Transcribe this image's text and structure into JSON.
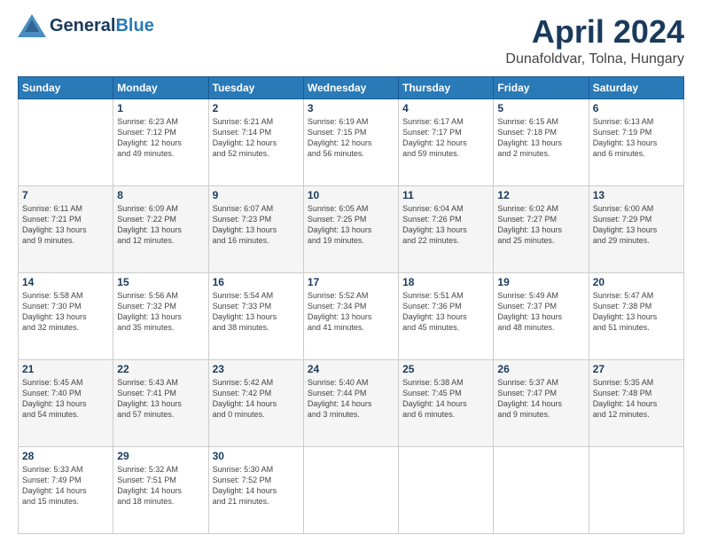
{
  "header": {
    "logo_general": "General",
    "logo_blue": "Blue",
    "title": "April 2024",
    "subtitle": "Dunafoldvar, Tolna, Hungary"
  },
  "days": [
    "Sunday",
    "Monday",
    "Tuesday",
    "Wednesday",
    "Thursday",
    "Friday",
    "Saturday"
  ],
  "weeks": [
    [
      {
        "day": "",
        "content": ""
      },
      {
        "day": "1",
        "content": "Sunrise: 6:23 AM\nSunset: 7:12 PM\nDaylight: 12 hours\nand 49 minutes."
      },
      {
        "day": "2",
        "content": "Sunrise: 6:21 AM\nSunset: 7:14 PM\nDaylight: 12 hours\nand 52 minutes."
      },
      {
        "day": "3",
        "content": "Sunrise: 6:19 AM\nSunset: 7:15 PM\nDaylight: 12 hours\nand 56 minutes."
      },
      {
        "day": "4",
        "content": "Sunrise: 6:17 AM\nSunset: 7:17 PM\nDaylight: 12 hours\nand 59 minutes."
      },
      {
        "day": "5",
        "content": "Sunrise: 6:15 AM\nSunset: 7:18 PM\nDaylight: 13 hours\nand 2 minutes."
      },
      {
        "day": "6",
        "content": "Sunrise: 6:13 AM\nSunset: 7:19 PM\nDaylight: 13 hours\nand 6 minutes."
      }
    ],
    [
      {
        "day": "7",
        "content": "Sunrise: 6:11 AM\nSunset: 7:21 PM\nDaylight: 13 hours\nand 9 minutes."
      },
      {
        "day": "8",
        "content": "Sunrise: 6:09 AM\nSunset: 7:22 PM\nDaylight: 13 hours\nand 12 minutes."
      },
      {
        "day": "9",
        "content": "Sunrise: 6:07 AM\nSunset: 7:23 PM\nDaylight: 13 hours\nand 16 minutes."
      },
      {
        "day": "10",
        "content": "Sunrise: 6:05 AM\nSunset: 7:25 PM\nDaylight: 13 hours\nand 19 minutes."
      },
      {
        "day": "11",
        "content": "Sunrise: 6:04 AM\nSunset: 7:26 PM\nDaylight: 13 hours\nand 22 minutes."
      },
      {
        "day": "12",
        "content": "Sunrise: 6:02 AM\nSunset: 7:27 PM\nDaylight: 13 hours\nand 25 minutes."
      },
      {
        "day": "13",
        "content": "Sunrise: 6:00 AM\nSunset: 7:29 PM\nDaylight: 13 hours\nand 29 minutes."
      }
    ],
    [
      {
        "day": "14",
        "content": "Sunrise: 5:58 AM\nSunset: 7:30 PM\nDaylight: 13 hours\nand 32 minutes."
      },
      {
        "day": "15",
        "content": "Sunrise: 5:56 AM\nSunset: 7:32 PM\nDaylight: 13 hours\nand 35 minutes."
      },
      {
        "day": "16",
        "content": "Sunrise: 5:54 AM\nSunset: 7:33 PM\nDaylight: 13 hours\nand 38 minutes."
      },
      {
        "day": "17",
        "content": "Sunrise: 5:52 AM\nSunset: 7:34 PM\nDaylight: 13 hours\nand 41 minutes."
      },
      {
        "day": "18",
        "content": "Sunrise: 5:51 AM\nSunset: 7:36 PM\nDaylight: 13 hours\nand 45 minutes."
      },
      {
        "day": "19",
        "content": "Sunrise: 5:49 AM\nSunset: 7:37 PM\nDaylight: 13 hours\nand 48 minutes."
      },
      {
        "day": "20",
        "content": "Sunrise: 5:47 AM\nSunset: 7:38 PM\nDaylight: 13 hours\nand 51 minutes."
      }
    ],
    [
      {
        "day": "21",
        "content": "Sunrise: 5:45 AM\nSunset: 7:40 PM\nDaylight: 13 hours\nand 54 minutes."
      },
      {
        "day": "22",
        "content": "Sunrise: 5:43 AM\nSunset: 7:41 PM\nDaylight: 13 hours\nand 57 minutes."
      },
      {
        "day": "23",
        "content": "Sunrise: 5:42 AM\nSunset: 7:42 PM\nDaylight: 14 hours\nand 0 minutes."
      },
      {
        "day": "24",
        "content": "Sunrise: 5:40 AM\nSunset: 7:44 PM\nDaylight: 14 hours\nand 3 minutes."
      },
      {
        "day": "25",
        "content": "Sunrise: 5:38 AM\nSunset: 7:45 PM\nDaylight: 14 hours\nand 6 minutes."
      },
      {
        "day": "26",
        "content": "Sunrise: 5:37 AM\nSunset: 7:47 PM\nDaylight: 14 hours\nand 9 minutes."
      },
      {
        "day": "27",
        "content": "Sunrise: 5:35 AM\nSunset: 7:48 PM\nDaylight: 14 hours\nand 12 minutes."
      }
    ],
    [
      {
        "day": "28",
        "content": "Sunrise: 5:33 AM\nSunset: 7:49 PM\nDaylight: 14 hours\nand 15 minutes."
      },
      {
        "day": "29",
        "content": "Sunrise: 5:32 AM\nSunset: 7:51 PM\nDaylight: 14 hours\nand 18 minutes."
      },
      {
        "day": "30",
        "content": "Sunrise: 5:30 AM\nSunset: 7:52 PM\nDaylight: 14 hours\nand 21 minutes."
      },
      {
        "day": "",
        "content": ""
      },
      {
        "day": "",
        "content": ""
      },
      {
        "day": "",
        "content": ""
      },
      {
        "day": "",
        "content": ""
      }
    ]
  ]
}
